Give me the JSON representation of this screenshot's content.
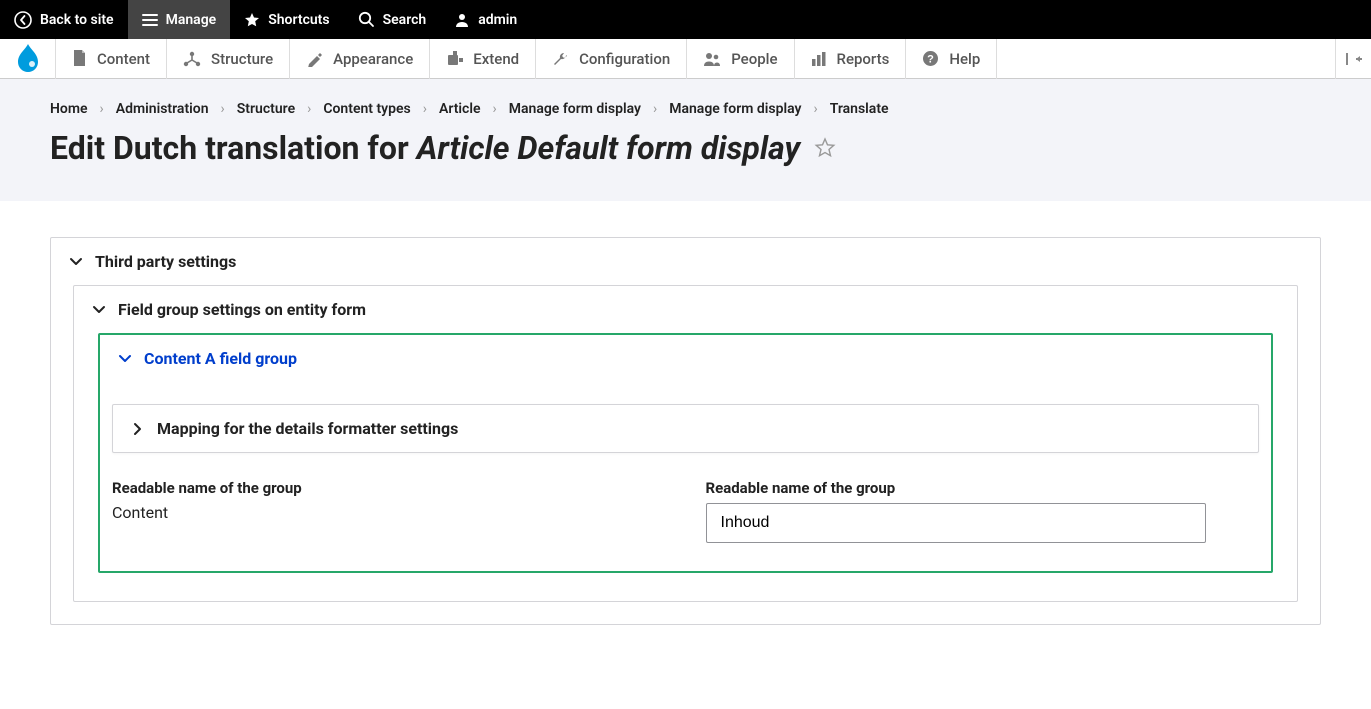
{
  "toolbar_black": {
    "back": "Back to site",
    "manage": "Manage",
    "shortcuts": "Shortcuts",
    "search": "Search",
    "admin": "admin"
  },
  "toolbar_white": {
    "content": "Content",
    "structure": "Structure",
    "appearance": "Appearance",
    "extend": "Extend",
    "configuration": "Configuration",
    "people": "People",
    "reports": "Reports",
    "help": "Help"
  },
  "breadcrumb": {
    "home": "Home",
    "admin": "Administration",
    "structure": "Structure",
    "content_types": "Content types",
    "article": "Article",
    "manage_form1": "Manage form display",
    "manage_form2": "Manage form display",
    "translate": "Translate"
  },
  "page_title": {
    "prefix": "Edit Dutch translation for ",
    "italic": "Article Default form display"
  },
  "details": {
    "third_party": "Third party settings",
    "field_group": "Field group settings on entity form",
    "content_a": "Content A field group",
    "mapping": "Mapping for the details formatter settings"
  },
  "form": {
    "label_source": "Readable name of the group",
    "value_source": "Content",
    "label_target": "Readable name of the group",
    "value_target": "Inhoud"
  }
}
